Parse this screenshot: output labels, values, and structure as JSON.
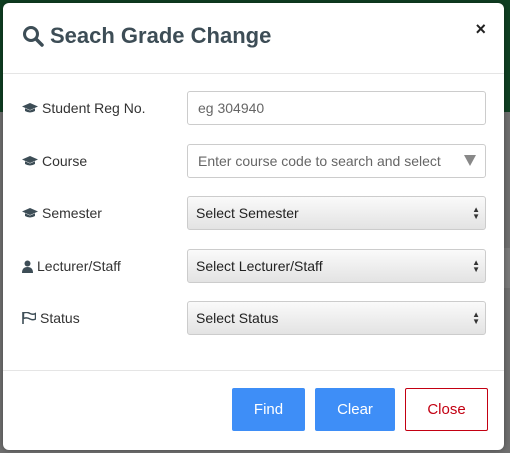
{
  "modal": {
    "title": "Seach Grade Change",
    "close_glyph": "×"
  },
  "fields": [
    {
      "label": "Student Reg No.",
      "icon": "graduation-cap-icon",
      "type": "text",
      "placeholder": "eg 304940",
      "value": ""
    },
    {
      "label": "Course",
      "icon": "graduation-cap-icon",
      "type": "combobox",
      "placeholder": "Enter course code to search and select"
    },
    {
      "label": "Semester",
      "icon": "graduation-cap-icon",
      "type": "select",
      "selected": "Select Semester"
    },
    {
      "label": "Lecturer/Staff",
      "icon": "user-icon",
      "type": "select",
      "selected": "Select Lecturer/Staff"
    },
    {
      "label": "Status",
      "icon": "flag-icon",
      "type": "select",
      "selected": "Select Status"
    }
  ],
  "buttons": {
    "find": "Find",
    "clear": "Clear",
    "close": "Close"
  },
  "colors": {
    "primary": "#3e8ef7",
    "danger": "#c30012",
    "title": "#3d4d56"
  }
}
